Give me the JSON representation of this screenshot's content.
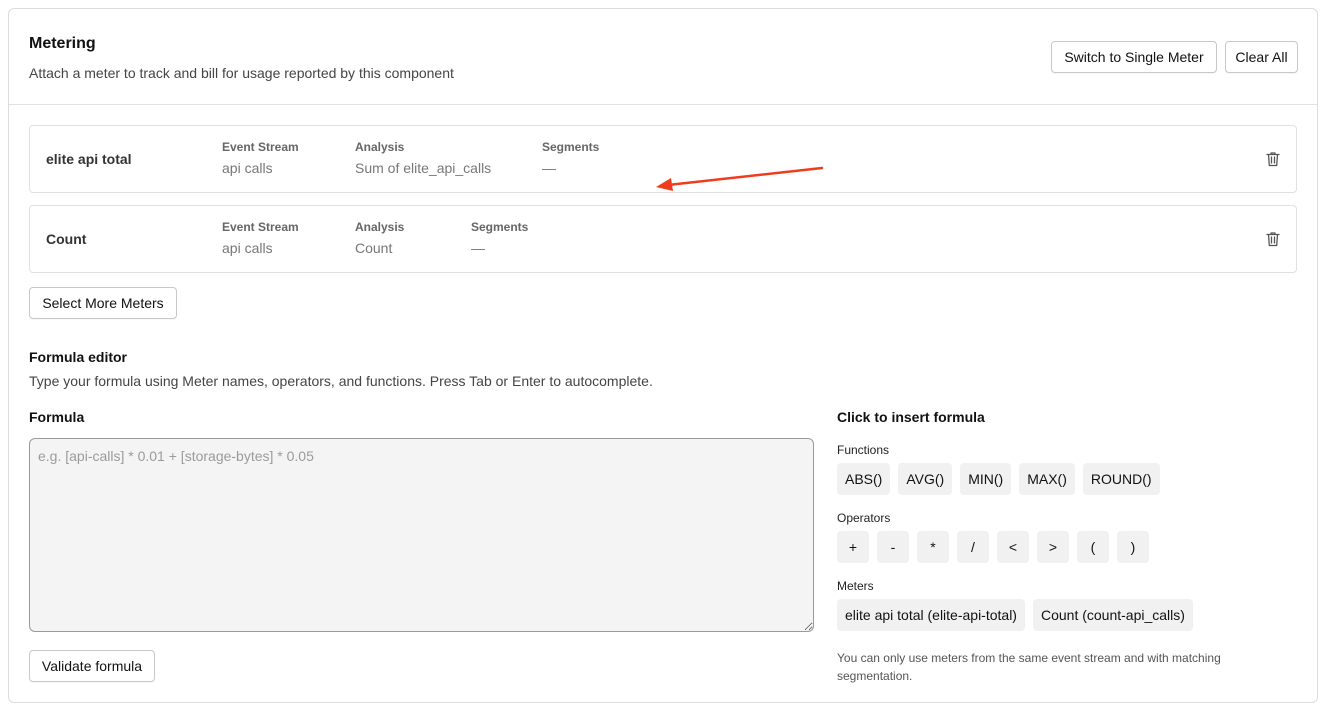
{
  "header": {
    "title": "Metering",
    "subtitle": "Attach a meter to track and bill for usage reported by this component",
    "switch_label": "Switch to Single Meter",
    "clear_label": "Clear All"
  },
  "meters": [
    {
      "name": "elite api total",
      "event_stream_label": "Event Stream",
      "event_stream": "api calls",
      "analysis_label": "Analysis",
      "analysis": "Sum of elite_api_calls",
      "segments_label": "Segments",
      "segments": "—"
    },
    {
      "name": "Count",
      "event_stream_label": "Event Stream",
      "event_stream": "api calls",
      "analysis_label": "Analysis",
      "analysis": "Count",
      "segments_label": "Segments",
      "segments": "—"
    }
  ],
  "select_more_label": "Select More Meters",
  "formula_editor": {
    "title": "Formula editor",
    "description": "Type your formula using Meter names, operators, and functions. Press Tab or Enter to autocomplete.",
    "formula_label": "Formula",
    "placeholder": "e.g. [api-calls] * 0.01 + [storage-bytes] * 0.05",
    "value": "",
    "validate_label": "Validate formula"
  },
  "insert": {
    "title": "Click to insert formula",
    "functions_label": "Functions",
    "functions": [
      "ABS()",
      "AVG()",
      "MIN()",
      "MAX()",
      "ROUND()"
    ],
    "operators_label": "Operators",
    "operators": [
      "+",
      "-",
      "*",
      "/",
      "<",
      ">",
      "(",
      ")"
    ],
    "meters_label": "Meters",
    "meters": [
      "elite api total (elite-api-total)",
      "Count (count-api_calls)"
    ],
    "note": "You can only use meters from the same event stream and with matching segmentation."
  },
  "colors": {
    "annotation_arrow": "#f03c1e"
  },
  "icons": {
    "delete": "trash-icon"
  }
}
